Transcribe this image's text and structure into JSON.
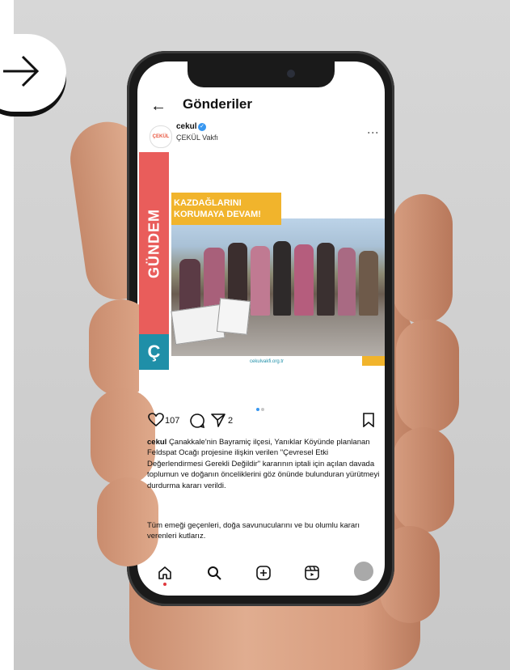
{
  "header": {
    "back_icon": "arrow-left-icon",
    "title": "Gönderiler"
  },
  "post": {
    "avatar_text": "ÇEKÜL",
    "username": "cekul",
    "verified_icon": "verified-badge-icon",
    "subtitle": "ÇEKÜL Vakfı",
    "more_icon": "more-vertical-icon",
    "image": {
      "side_label": "GÜNDEM",
      "side_logo": "Ç",
      "banner": "KAZDAĞLARINI KORUMAYA DEVAM!",
      "site": "cekulvakfi.org.tr"
    },
    "carousel": {
      "count": 2,
      "active": 1
    },
    "actions": {
      "like_count": "107",
      "share_count": "2"
    },
    "caption_username": "cekul",
    "caption_text": "Çanakkale'nin Bayramiç ilçesi, Yanıklar Köyünde planlanan Feldspat Ocağı projesine ilişkin verilen \"Çevresel Etki Değerlendirmesi Gerekli Değildir\" kararının iptali için açılan davada toplumun ve doğanın önceliklerini göz önünde bulunduran yürütmeyi durdurma kararı verildi.",
    "caption_text_2": "Tüm emeği geçenleri, doğa savunucularını ve bu olumlu kararı verenleri kutlarız."
  },
  "nav": {
    "items": [
      "home-icon",
      "search-icon",
      "create-icon",
      "reels-icon",
      "profile-avatar"
    ]
  },
  "colors": {
    "red": "#e95d5b",
    "teal": "#1f8fa8",
    "yellow": "#f1b42c",
    "instagram_blue": "#3897f0"
  }
}
